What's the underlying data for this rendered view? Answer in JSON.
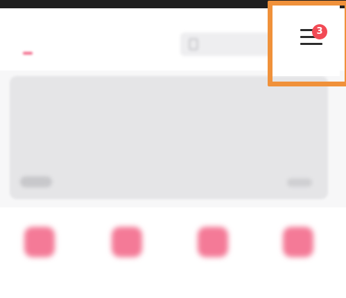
{
  "status_bar": {
    "text": ""
  },
  "header": {
    "tab_active": "",
    "tab_second": "",
    "search": {
      "placeholder": ""
    }
  },
  "menu": {
    "badge_count": "3",
    "icon": "hamburger-menu-icon",
    "highlight_color": "#f0913a"
  },
  "banner": {
    "left_tag": "",
    "right_tag": ""
  },
  "quick_actions": [
    {
      "label": "",
      "icon": "app-icon"
    },
    {
      "label": "",
      "icon": "app-icon"
    },
    {
      "label": "",
      "icon": "app-icon"
    },
    {
      "label": "",
      "icon": "app-icon"
    }
  ],
  "colors": {
    "accent": "#f26a8a",
    "badge": "#f24a55",
    "highlight": "#f0913a"
  }
}
